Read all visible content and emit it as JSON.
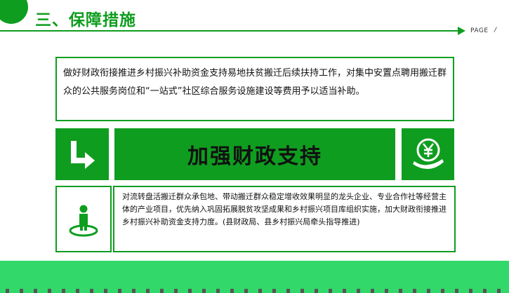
{
  "header": {
    "title": "三、保障措施",
    "page_label": "PAGE",
    "page_number": "/"
  },
  "intro": {
    "text": "做好财政衔接推进乡村振兴补助资金支持易地扶贫搬迁后续扶持工作，对集中安置点聘用搬迁群众的公共服务岗位和“一站式”社区综合服务设施建设等费用予以适当补助。"
  },
  "banner": {
    "title": "加强财政支持",
    "left_icon": "turn-arrow-icon",
    "right_icon": "yuan-coin-hand-icon"
  },
  "detail": {
    "icon": "person-location-icon",
    "text": "对流转盘活搬迁群众承包地、带动搬迁群众稳定增收效果明显的龙头企业、专业合作社等经营主体的产业项目，优先纳入巩固拓展脱贫攻坚成果和乡村振兴项目库组织实施，加大财政衔接推进乡村振兴补助资金支持力度。(县财政局、县乡村振兴局牵头指导推进)"
  },
  "colors": {
    "primary_green": "#0f9d1f",
    "band_green": "#33d86b"
  }
}
